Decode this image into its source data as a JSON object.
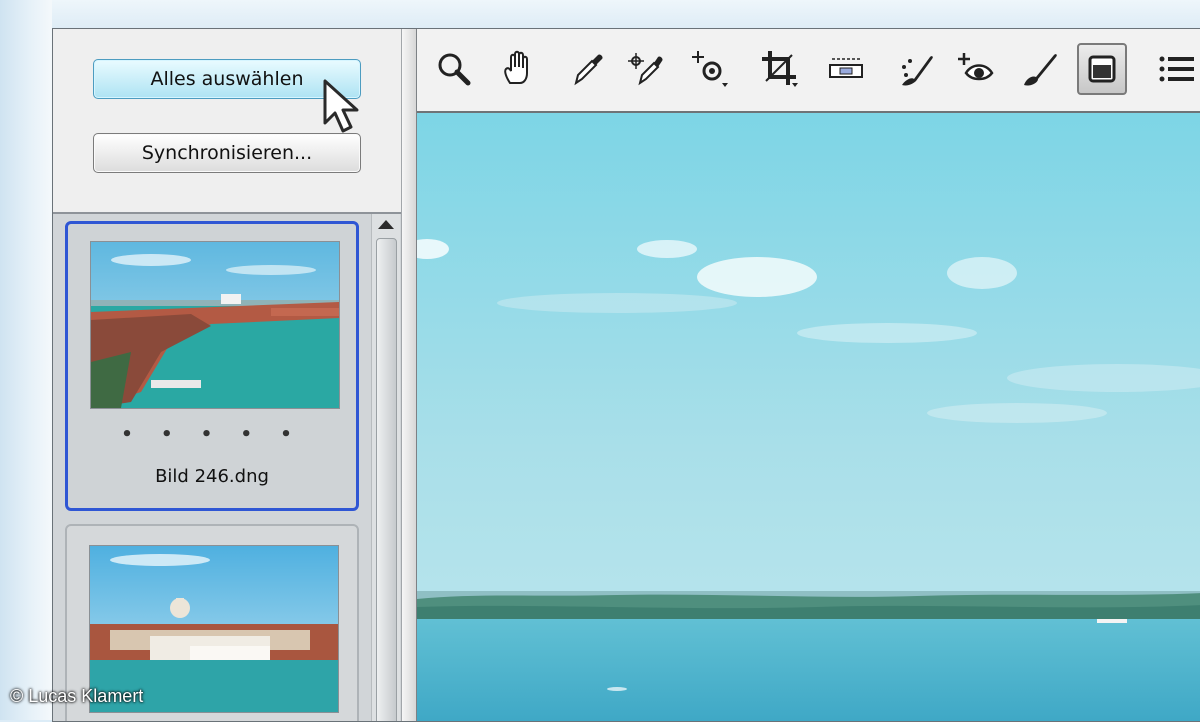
{
  "left_panel": {
    "select_all_label": "Alles auswählen",
    "sync_label": "Synchronisieren..."
  },
  "filmstrip": {
    "items": [
      {
        "rating_dots": "• • • • •",
        "filename": "Bild 246.dng",
        "selected": true
      },
      {
        "rating_dots": "",
        "filename": "",
        "selected": false
      }
    ]
  },
  "toolbar": {
    "tools": [
      "zoom-icon",
      "hand-icon",
      "eyedropper-icon",
      "color-sampler-icon",
      "target-adjust-icon",
      "crop-icon",
      "straighten-icon",
      "spot-removal-icon",
      "red-eye-icon",
      "brush-icon",
      "preview-toggle-icon",
      "list-icon"
    ]
  },
  "watermark": "© Lucas Klamert",
  "colors": {
    "select_button": "#aee3f3",
    "selection_border": "#2f56d4",
    "sky": "#7fd3e2",
    "water": "#3ba8c4"
  }
}
